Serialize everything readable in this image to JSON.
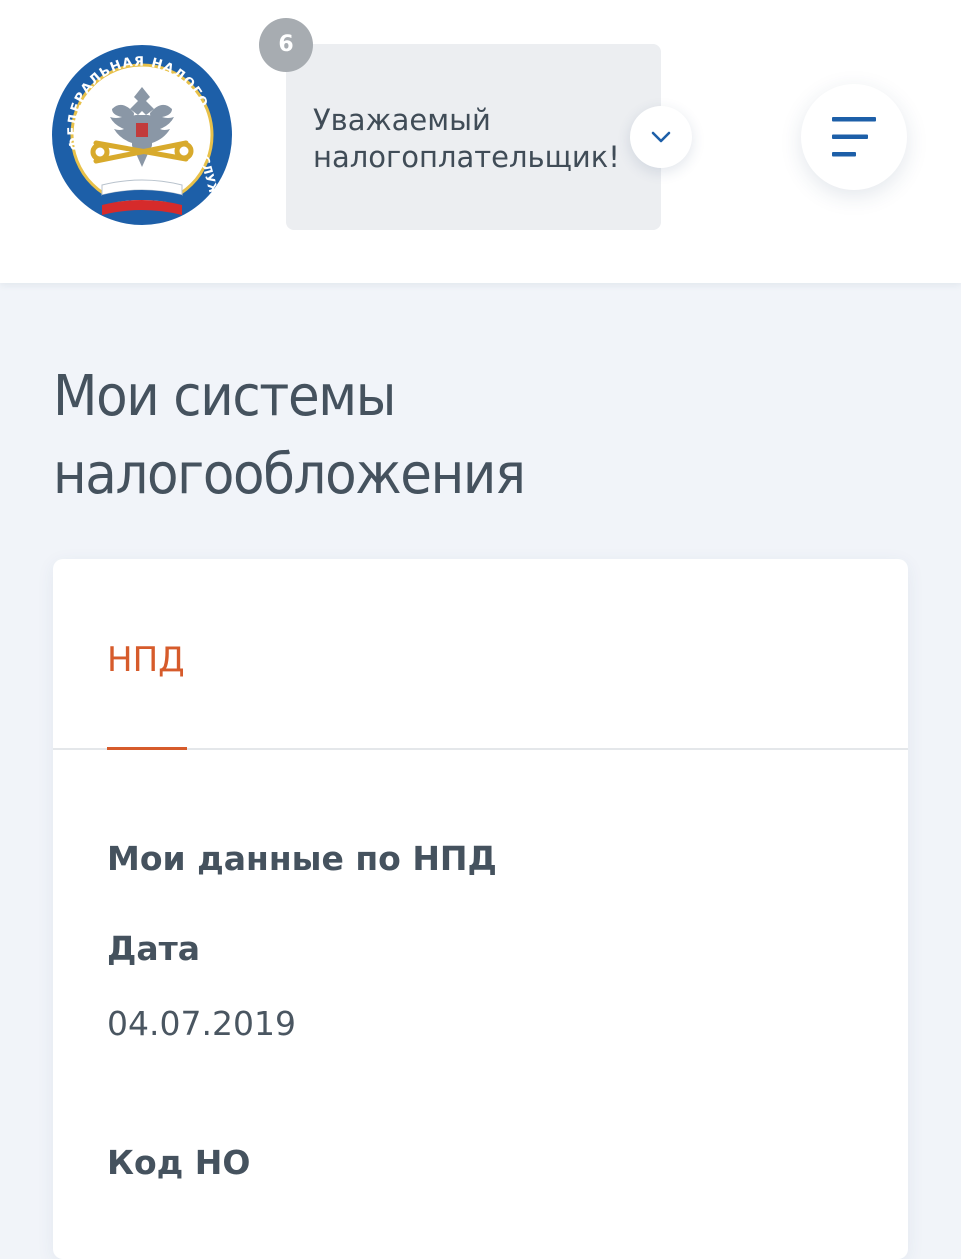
{
  "header": {
    "logo": {
      "arc_text_top": "ФЕДЕРАЛЬНАЯ НАЛОГОВАЯ",
      "arc_text_side": "СЛУЖБА",
      "icon": "fns-emblem-icon"
    },
    "notification_count": "6",
    "greeting": "Уважаемый налогоплательщик!",
    "dropdown_icon": "chevron-down-icon",
    "menu_icon": "hamburger-menu-icon"
  },
  "page": {
    "title": "Мои системы налогообложения"
  },
  "card": {
    "tabs": [
      {
        "label": "НПД",
        "active": true
      }
    ],
    "section_title": "Мои данные по НПД",
    "fields": [
      {
        "label": "Дата",
        "value": "04.07.2019"
      },
      {
        "label": "Код НО",
        "value": ""
      }
    ]
  },
  "colors": {
    "accent": "#d65b2b",
    "brand_blue": "#1d5fa8",
    "text": "#45525e",
    "background": "#f1f4f9"
  }
}
